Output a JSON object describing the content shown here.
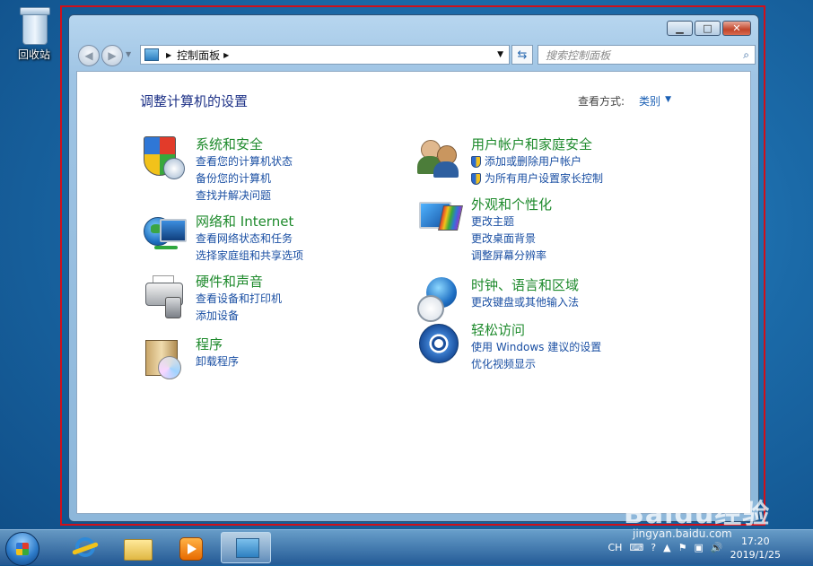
{
  "desktop": {
    "recycle_bin_label": "回收站"
  },
  "window": {
    "address": {
      "path": "控制面板"
    },
    "search": {
      "placeholder": "搜索控制面板"
    },
    "page_title": "调整计算机的设置",
    "view_by": {
      "label": "查看方式:",
      "value": "类别"
    },
    "categories_left": [
      {
        "title": "系统和安全",
        "icon": "security-shield-icon",
        "links": [
          "查看您的计算机状态",
          "备份您的计算机",
          "查找并解决问题"
        ]
      },
      {
        "title": "网络和 Internet",
        "icon": "network-globe-icon",
        "links": [
          "查看网络状态和任务",
          "选择家庭组和共享选项"
        ]
      },
      {
        "title": "硬件和声音",
        "icon": "printer-speaker-icon",
        "links": [
          "查看设备和打印机",
          "添加设备"
        ]
      },
      {
        "title": "程序",
        "icon": "programs-box-icon",
        "links": [
          "卸载程序"
        ]
      }
    ],
    "categories_right": [
      {
        "title": "用户帐户和家庭安全",
        "icon": "users-icon",
        "links": [
          "添加或删除用户帐户",
          "为所有用户设置家长控制"
        ]
      },
      {
        "title": "外观和个性化",
        "icon": "appearance-monitor-icon",
        "links": [
          "更改主题",
          "更改桌面背景",
          "调整屏幕分辨率"
        ]
      },
      {
        "title": "时钟、语言和区域",
        "icon": "clock-globe-icon",
        "links": [
          "更改键盘或其他输入法"
        ]
      },
      {
        "title": "轻松访问",
        "icon": "ease-of-access-icon",
        "links": [
          "使用 Windows 建议的设置",
          "优化视频显示"
        ]
      }
    ]
  },
  "taskbar": {
    "tray": {
      "lang": "CH",
      "time": "17:20",
      "date": "2019/1/25"
    }
  },
  "watermark": {
    "brand": "Baidu经验",
    "url": "jingyan.baidu.com"
  }
}
